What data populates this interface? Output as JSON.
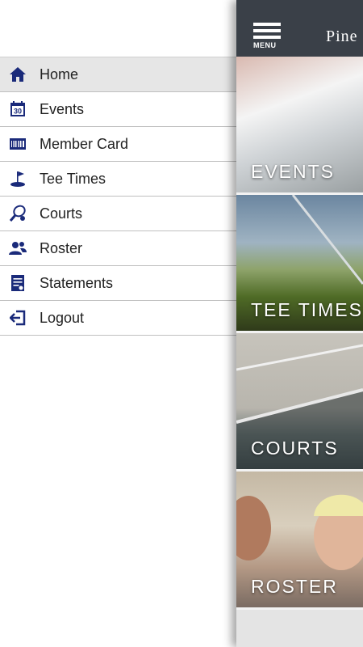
{
  "drawer": {
    "items": [
      {
        "label": "Home",
        "icon": "home-icon",
        "active": true
      },
      {
        "label": "Events",
        "icon": "calendar-icon",
        "active": false
      },
      {
        "label": "Member Card",
        "icon": "barcode-icon",
        "active": false
      },
      {
        "label": "Tee Times",
        "icon": "golf-flag-icon",
        "active": false
      },
      {
        "label": "Courts",
        "icon": "tennis-racket-icon",
        "active": false
      },
      {
        "label": "Roster",
        "icon": "people-icon",
        "active": false
      },
      {
        "label": "Statements",
        "icon": "document-icon",
        "active": false
      },
      {
        "label": "Logout",
        "icon": "logout-icon",
        "active": false
      }
    ],
    "calendar_day": "30"
  },
  "topbar": {
    "menu_label": "MENU",
    "brand": "Pine"
  },
  "tiles": [
    {
      "caption": "EVENTS"
    },
    {
      "caption": "TEE TIMES"
    },
    {
      "caption": "COURTS"
    },
    {
      "caption": "ROSTER"
    }
  ],
  "colors": {
    "icon": "#1a2a7a",
    "topbar": "#3a4048",
    "active_row": "#e6e6e6"
  }
}
